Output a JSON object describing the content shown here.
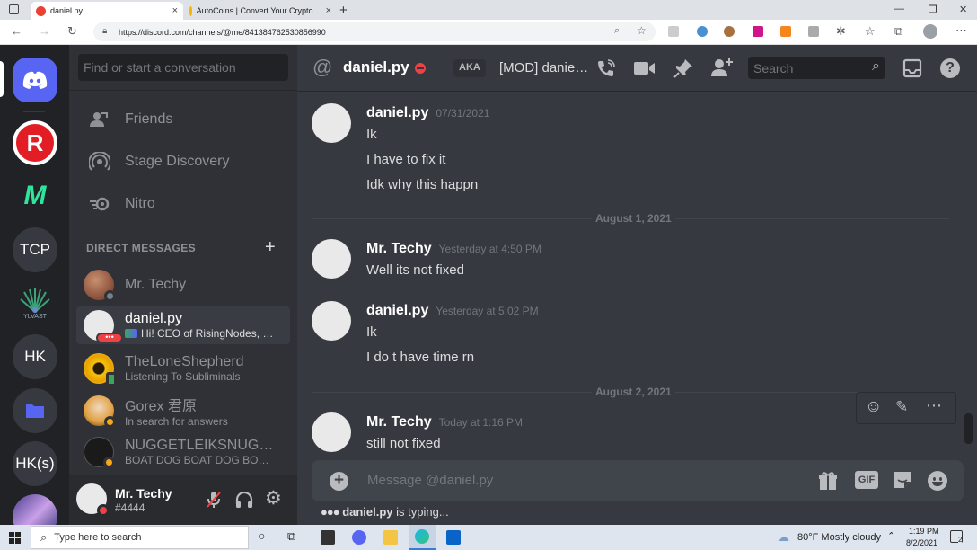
{
  "browser": {
    "tabs": [
      {
        "label": "daniel.py",
        "close": "×"
      },
      {
        "label": "AutoCoins | Convert Your Crypto…",
        "close": "×"
      }
    ],
    "new_tab": "+",
    "url": "https://discord.com/channels/@me/841384762530856990",
    "window_controls": [
      "—",
      "❐",
      "✕"
    ]
  },
  "servers": [
    {
      "name": "discord-home",
      "label": ""
    },
    {
      "name": "R",
      "label": "R",
      "color": "#e21d26"
    },
    {
      "name": "M",
      "label": "M",
      "color": "#2f3136"
    },
    {
      "name": "TCP",
      "label": "TCP",
      "color": "#36393f"
    },
    {
      "name": "YLVAST",
      "label": "YLVAST",
      "color": "#202225"
    },
    {
      "name": "HK",
      "label": "HK",
      "color": "#36393f"
    },
    {
      "name": "folder",
      "label": "",
      "color": "#36393f"
    },
    {
      "name": "HK(s)",
      "label": "HK(s)",
      "color": "#36393f"
    }
  ],
  "dm_sidebar": {
    "search_placeholder": "Find or start a conversation",
    "nav": [
      {
        "label": "Friends"
      },
      {
        "label": "Stage Discovery"
      },
      {
        "label": "Nitro"
      }
    ],
    "dm_header": "DIRECT MESSAGES",
    "dm_add": "+",
    "dms": [
      {
        "name": "Mr. Techy",
        "sub": ""
      },
      {
        "name": "daniel.py",
        "sub": "Hi! CEO of RisingNodes, …"
      },
      {
        "name": "TheLoneShepherd",
        "sub": "Listening To Subliminals"
      },
      {
        "name": "Gorex 君原",
        "sub": "In search for answers"
      },
      {
        "name": "NUGGETLEIKSNUG…",
        "sub": "BOAT DOG BOAT DOG BO…"
      }
    ]
  },
  "user_panel": {
    "name": "Mr. Techy",
    "tag": "#4444"
  },
  "chat_header": {
    "at": "@",
    "name": "daniel.py",
    "aka_label": "AKA",
    "aka_value": "[MOD] danie…",
    "search_placeholder": "Search"
  },
  "messages": [
    {
      "author": "daniel.py",
      "time": "07/31/2021",
      "lines": [
        "Ik",
        "I have to fix it",
        "Idk why this happn"
      ]
    },
    {
      "divider": "August 1, 2021"
    },
    {
      "author": "Mr. Techy",
      "time": "Yesterday at 4:50 PM",
      "lines": [
        "Well its not fixed"
      ]
    },
    {
      "author": "daniel.py",
      "time": "Yesterday at 5:02 PM",
      "lines": [
        "Ik",
        "I do t have time rn"
      ]
    },
    {
      "divider": "August 2, 2021"
    },
    {
      "author": "Mr. Techy",
      "time": "Today at 1:16 PM",
      "lines": [
        "still not fixed"
      ]
    }
  ],
  "composer": {
    "placeholder": "Message @daniel.py",
    "gif": "GIF"
  },
  "typing": {
    "user": "daniel.py",
    "text": " is typing..."
  },
  "taskbar": {
    "search_placeholder": "Type here to search",
    "weather": "80°F  Mostly cloudy",
    "time": "1:19 PM",
    "date": "8/2/2021",
    "notif_count": "2"
  },
  "colors": {
    "blurple": "#5865f2",
    "dnd_red": "#ed4245",
    "bg": "#36393f"
  }
}
